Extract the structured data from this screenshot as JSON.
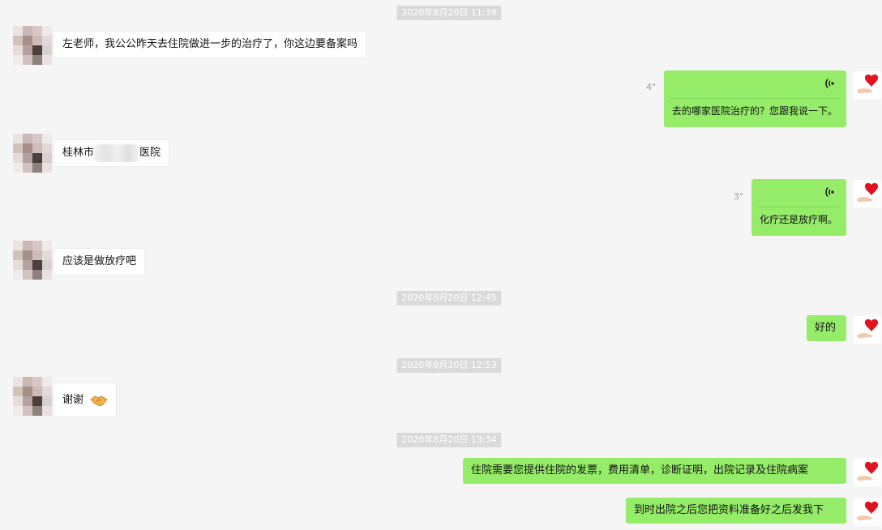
{
  "timestamps": [
    "2020年8月20日 11:39",
    "2020年8月20日 12:45",
    "2020年8月20日 12:53",
    "2020年8月20日 13:34"
  ],
  "messages": [
    {
      "side": "left",
      "text": "左老师，我公公昨天去住院做进一步的治疗了，你这边要备案吗"
    },
    {
      "side": "right",
      "type": "voice",
      "duration": "4\"",
      "transcript": "去的哪家医院治疗的？您跟我说一下。"
    },
    {
      "side": "left",
      "text_before": "桂林市",
      "text_after": "医院"
    },
    {
      "side": "right",
      "type": "voice",
      "duration": "3\"",
      "transcript": "化疗还是放疗啊。"
    },
    {
      "side": "left",
      "text": "应该是做放疗吧"
    },
    {
      "side": "right",
      "text": "好的"
    },
    {
      "side": "left",
      "text": "谢谢",
      "emoji": "handshake-emoji"
    },
    {
      "side": "right",
      "text": "住院需要您提供住院的发票，费用清单，诊断证明，出院记录及住院病案"
    },
    {
      "side": "right",
      "text": "到时出院之后您把资料准备好之后发我下"
    }
  ],
  "colors": {
    "background": "#f5f5f5",
    "bubble_sent": "#95ec69",
    "bubble_received": "#ffffff",
    "timestamp_bg": "#dadada",
    "duration_text": "#999999"
  },
  "icons": {
    "voice": "voice-wave-icon",
    "self_avatar": "heart-in-hand-avatar",
    "contact_avatar": "pixelated-avatar"
  }
}
